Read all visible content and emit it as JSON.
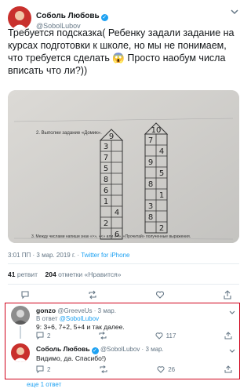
{
  "tweet": {
    "author_name": "Соболь Любовь",
    "author_handle": "@SobolLubov",
    "text": "Требуется подсказка( Ребенку задали задание на курсах подготовки к школе, но мы не понимаем, что требуется сделать 😱 Просто наобум числа вписать что ли?))",
    "time": "3:01 ПП · 3 мар. 2019 г. · ",
    "source": "Twitter for iPhone",
    "retweets_count": "41",
    "retweets_label": "ретвит",
    "likes_count": "204",
    "likes_label": "отметки «Нравится»"
  },
  "worksheet": {
    "task_heading": "2. Выполни задание «Домик».",
    "footer_text": "3. Между числами напиши знак «>», «<» или «=». «Прочитай» полученные выражения.",
    "house_left": {
      "roof": "9",
      "rows": [
        [
          "3",
          ""
        ],
        [
          "7",
          ""
        ],
        [
          "5",
          ""
        ],
        [
          "8",
          ""
        ],
        [
          "6",
          ""
        ],
        [
          "1",
          ""
        ],
        [
          "",
          "4"
        ],
        [
          "2",
          ""
        ],
        [
          "",
          "6"
        ]
      ]
    },
    "house_right": {
      "roof": "10",
      "rows": [
        [
          "7",
          ""
        ],
        [
          "",
          "4"
        ],
        [
          "9",
          ""
        ],
        [
          "",
          "5"
        ],
        [
          "8",
          ""
        ],
        [
          "",
          "1"
        ],
        [
          "3",
          ""
        ],
        [
          "8",
          ""
        ],
        [
          "",
          "2"
        ]
      ]
    }
  },
  "replies": [
    {
      "author_name": "gonzo",
      "author_handle": "@GreeveUs",
      "date": " · 3 мар.",
      "in_reply_prefix": "В ответ ",
      "in_reply_to": "@SobolLubov",
      "text": "9: 3+6, 7+2, 5+4 и так далее.",
      "reply_count": "2",
      "like_count": "117"
    },
    {
      "author_name": "Соболь Любовь",
      "author_handle": "@SobolLubov",
      "date": " · 3 мар.",
      "text": "Видимо, да. Спасибо!)",
      "reply_count": "2",
      "like_count": "26"
    }
  ],
  "more_replies": "еще 1 ответ",
  "colors": {
    "accent": "#1da1f2",
    "highlight": "#d0021b"
  }
}
